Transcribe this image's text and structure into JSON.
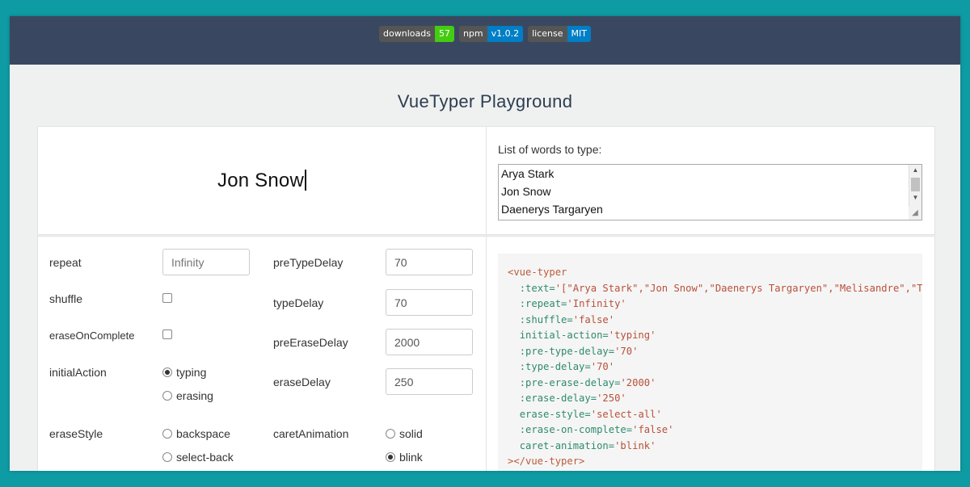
{
  "badges": [
    {
      "key": "downloads",
      "value": "57",
      "color": "#4c1"
    },
    {
      "key": "npm",
      "value": "v1.0.2",
      "color": "#007ec6"
    },
    {
      "key": "license",
      "value": "MIT",
      "color": "#007ec6"
    }
  ],
  "title": "VueTyper Playground",
  "preview": {
    "text": "Jon Snow"
  },
  "words": {
    "label": "List of words to type:",
    "lines": [
      "Arya Stark",
      "Jon Snow",
      "Daenerys Targaryen"
    ]
  },
  "options": {
    "repeat": {
      "label": "repeat",
      "value": "Infinity"
    },
    "shuffle": {
      "label": "shuffle"
    },
    "eraseOnComplete": {
      "label": "eraseOnComplete"
    },
    "initialAction": {
      "label": "initialAction",
      "options": [
        "typing",
        "erasing"
      ],
      "selected": "typing"
    },
    "eraseStyle": {
      "label": "eraseStyle",
      "options": [
        "backspace",
        "select-back"
      ]
    },
    "preTypeDelay": {
      "label": "preTypeDelay",
      "value": "70"
    },
    "typeDelay": {
      "label": "typeDelay",
      "value": "70"
    },
    "preEraseDelay": {
      "label": "preEraseDelay",
      "value": "2000"
    },
    "eraseDelay": {
      "label": "eraseDelay",
      "value": "250"
    },
    "caretAnimation": {
      "label": "caretAnimation",
      "options": [
        "solid",
        "blink"
      ],
      "selected": "blink"
    }
  },
  "code": {
    "open_tag": "<vue-typer",
    "text_attr": ":text=",
    "text_val": "'[\"Arya Stark\",\"Jon Snow\",\"Daenerys Targaryen\",\"Melisandre\",\"Ty",
    "repeat_attr": ":repeat=",
    "repeat_val": "'Infinity'",
    "shuffle_attr": ":shuffle=",
    "shuffle_val": "'false'",
    "initial_attr": "initial-action=",
    "initial_val": "'typing'",
    "pretype_attr": ":pre-type-delay=",
    "pretype_val": "'70'",
    "type_attr": ":type-delay=",
    "type_val": "'70'",
    "preerase_attr": ":pre-erase-delay=",
    "preerase_val": "'2000'",
    "erase_attr": ":erase-delay=",
    "erase_val": "'250'",
    "erasestyle_attr": "erase-style=",
    "erasestyle_val": "'select-all'",
    "eoc_attr": ":erase-on-complete=",
    "eoc_val": "'false'",
    "caret_attr": "caret-animation=",
    "caret_val": "'blink'",
    "close_tag": "></vue-typer>"
  }
}
